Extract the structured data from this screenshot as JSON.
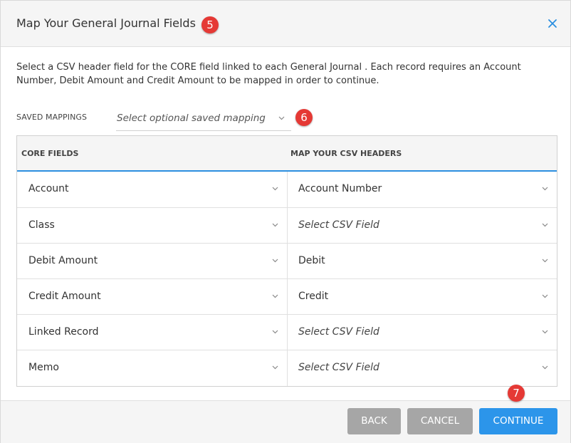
{
  "dialog": {
    "title": "Map Your General Journal Fields",
    "close_icon": "close-icon",
    "intro": "Select a CSV header field for the CORE field linked to each General Journal . Each record requires an Account Number, Debit Amount and Credit Amount to be mapped in order to continue."
  },
  "badges": {
    "title": "5",
    "saved_mapping": "6",
    "continue": "7"
  },
  "saved_mappings": {
    "label": "SAVED MAPPINGS",
    "value": "Select optional saved mapping"
  },
  "table": {
    "headers": {
      "core": "CORE FIELDS",
      "csv": "MAP YOUR CSV HEADERS"
    },
    "rows": [
      {
        "core": "Account",
        "csv": "Account Number",
        "csv_placeholder": false
      },
      {
        "core": "Class",
        "csv": "Select CSV Field",
        "csv_placeholder": true
      },
      {
        "core": "Debit Amount",
        "csv": "Debit",
        "csv_placeholder": false
      },
      {
        "core": "Credit Amount",
        "csv": "Credit",
        "csv_placeholder": false
      },
      {
        "core": "Linked Record",
        "csv": "Select CSV Field",
        "csv_placeholder": true
      },
      {
        "core": "Memo",
        "csv": "Select CSV Field",
        "csv_placeholder": true
      }
    ]
  },
  "footer": {
    "back": "BACK",
    "cancel": "CANCEL",
    "continue": "CONTINUE"
  },
  "colors": {
    "accent": "#2c95ea",
    "badge": "#e53935",
    "button_gray": "#a6a6a6"
  }
}
